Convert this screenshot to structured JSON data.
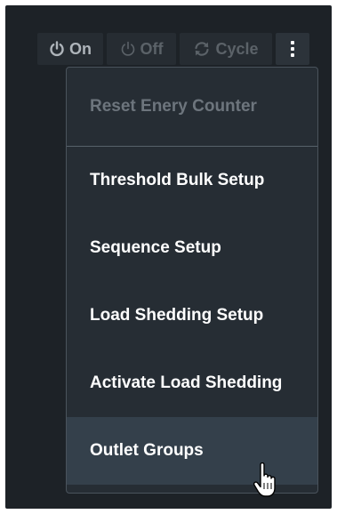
{
  "toolbar": {
    "on_label": "On",
    "off_label": "Off",
    "cycle_label": "Cycle",
    "more_icon": "kebab-menu-icon"
  },
  "menu": {
    "items": [
      {
        "label": "Reset Enery Counter",
        "disabled": true
      },
      {
        "label": "Threshold Bulk Setup"
      },
      {
        "label": "Sequence Setup"
      },
      {
        "label": "Load Shedding Setup"
      },
      {
        "label": "Activate Load Shedding"
      },
      {
        "label": "Outlet Groups",
        "hovered": true
      }
    ]
  },
  "colors": {
    "background": "#1d2227",
    "menu_bg": "#262d34",
    "hover_bg": "#34404b",
    "disabled_text": "#6d757d"
  }
}
